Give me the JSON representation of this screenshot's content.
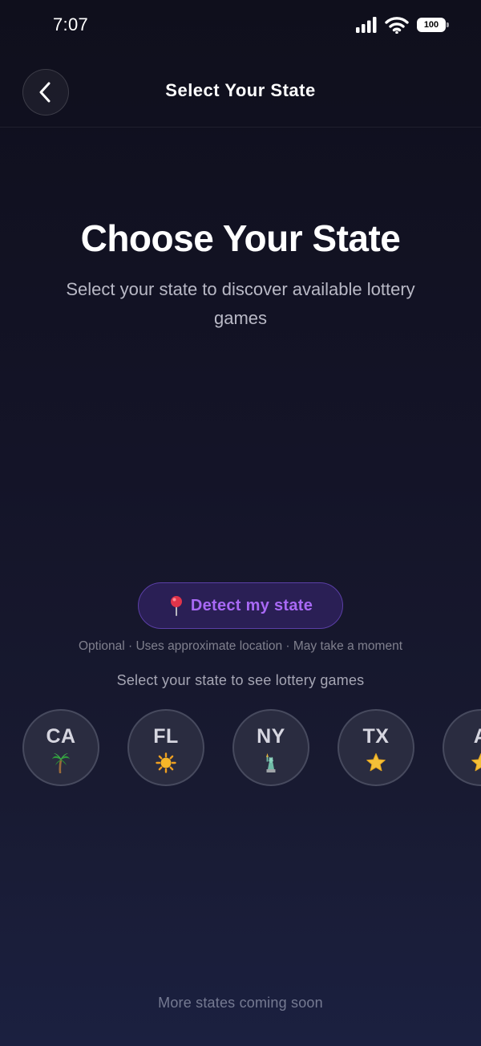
{
  "status_bar": {
    "time": "7:07",
    "battery": "100"
  },
  "header": {
    "title": "Select Your State",
    "back_icon": "chevron-left-icon"
  },
  "hero": {
    "title": "Choose Your State",
    "subtitle": "Select your state to discover available lottery games"
  },
  "detect": {
    "icon": "map-pin-icon",
    "label": "Detect my state",
    "note": "Optional · Uses approximate location · May take a moment"
  },
  "states_section": {
    "hint": "Select your state to see lottery games",
    "states": [
      {
        "code": "CA",
        "icon": "palm-tree-icon"
      },
      {
        "code": "FL",
        "icon": "sun-icon"
      },
      {
        "code": "NY",
        "icon": "statue-of-liberty-icon"
      },
      {
        "code": "TX",
        "icon": "star-icon"
      },
      {
        "code": "A",
        "icon": "star-icon"
      }
    ]
  },
  "footer": {
    "note": "More states coming soon"
  },
  "colors": {
    "accent": "#a869f5",
    "background_top": "#0f0f1c",
    "background_bottom": "#1b2040"
  }
}
